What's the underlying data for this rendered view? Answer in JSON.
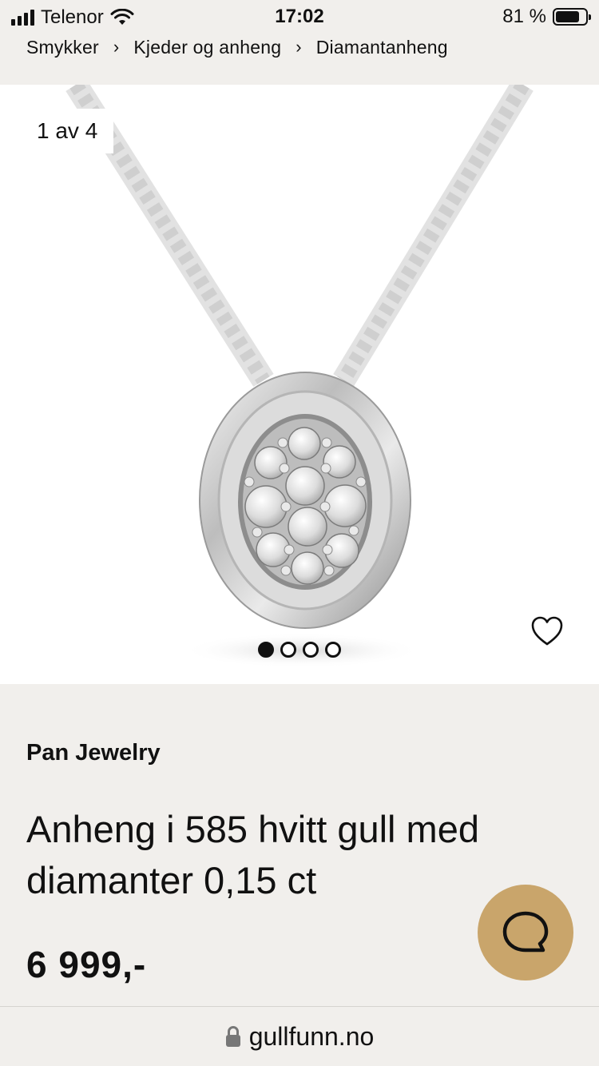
{
  "status_bar": {
    "carrier": "Telenor",
    "time": "17:02",
    "battery_percent": "81 %",
    "battery_level": 0.81
  },
  "breadcrumb": {
    "items": [
      "Smykker",
      "Kjeder og anheng",
      "Diamantanheng"
    ],
    "separator": "›"
  },
  "gallery": {
    "counter": "1 av 4",
    "total_images": 4,
    "active_index": 0
  },
  "product": {
    "brand": "Pan Jewelry",
    "title": "Anheng i 585 hvitt gull med diamanter 0,15 ct",
    "price": "6 999,-"
  },
  "url_bar": {
    "domain": "gullfunn.no"
  },
  "colors": {
    "background": "#f1efec",
    "chat_button": "#c9a56b",
    "text": "#111111"
  },
  "icons": {
    "favorite": "heart-outline-icon",
    "chat": "chat-bubble-icon",
    "lock": "lock-icon",
    "wifi": "wifi-icon",
    "signal": "signal-icon",
    "battery": "battery-icon"
  }
}
